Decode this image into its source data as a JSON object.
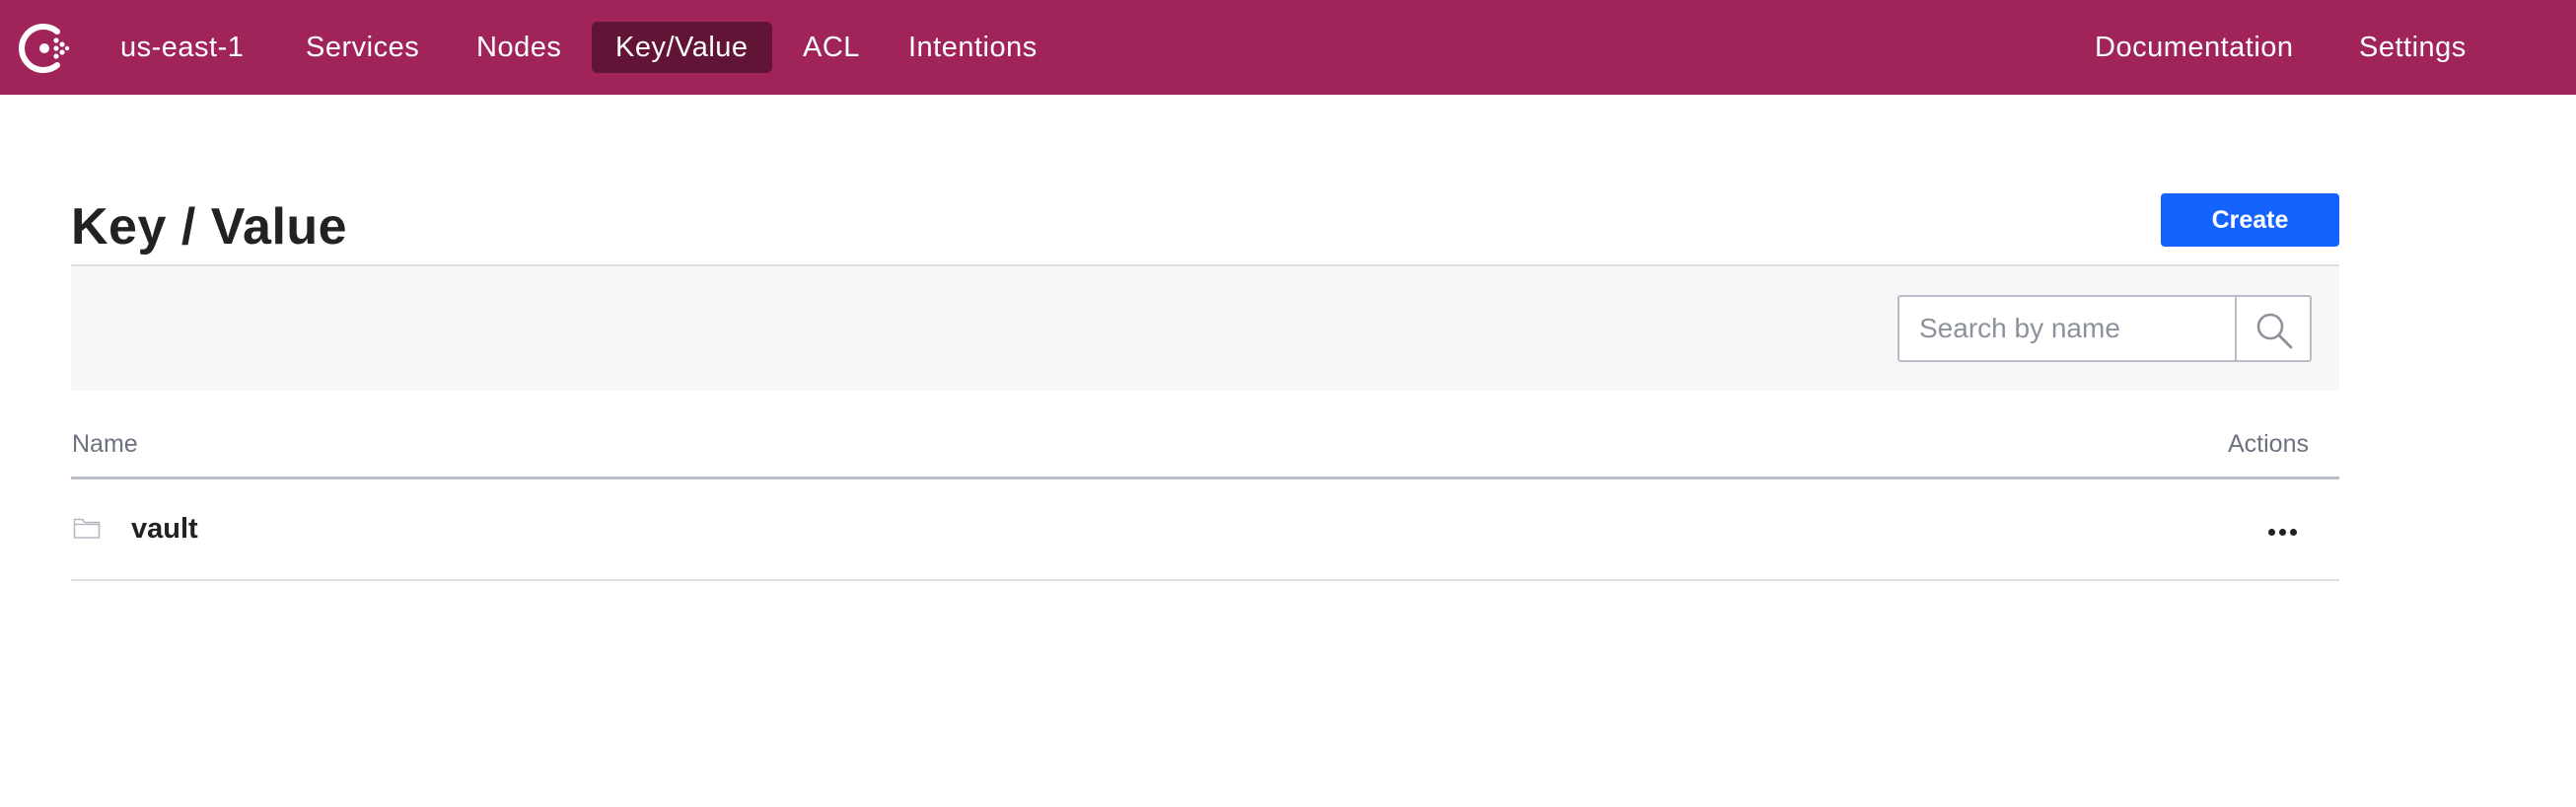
{
  "nav": {
    "datacenter": "us-east-1",
    "items": [
      {
        "label": "Services"
      },
      {
        "label": "Nodes"
      },
      {
        "label": "Key/Value",
        "active": true
      },
      {
        "label": "ACL"
      },
      {
        "label": "Intentions"
      }
    ],
    "right_items": [
      {
        "label": "Documentation"
      },
      {
        "label": "Settings"
      }
    ]
  },
  "page": {
    "title": "Key / Value",
    "create_label": "Create"
  },
  "search": {
    "placeholder": "Search by name",
    "value": ""
  },
  "table": {
    "columns": [
      "Name",
      "Actions"
    ],
    "rows": [
      {
        "name": "vault",
        "type": "folder"
      }
    ]
  },
  "colors": {
    "brand": "#a0245a",
    "nav_active": "#611435",
    "primary_button": "#1563ff"
  },
  "icons": {
    "logo": "consul-logo-icon",
    "search": "search-icon",
    "folder": "folder-icon",
    "actions": "more-horizontal-icon"
  }
}
